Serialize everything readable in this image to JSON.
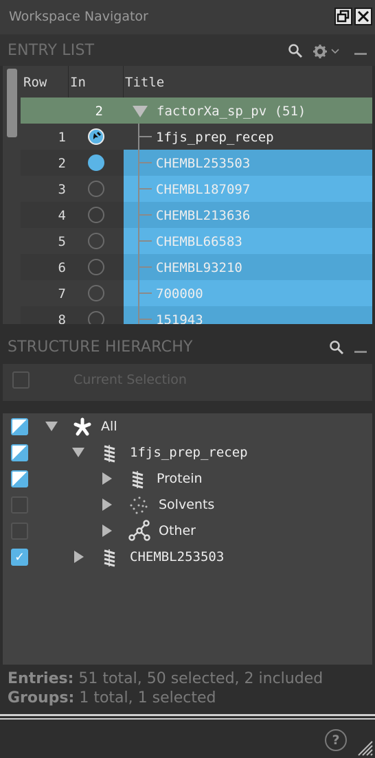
{
  "window": {
    "title": "Workspace Navigator",
    "restore_icon": "restore-icon",
    "close_icon": "close-icon"
  },
  "entry_list": {
    "header": "ENTRY LIST",
    "columns": [
      "Row",
      "In",
      "Title"
    ],
    "group": {
      "count": "2",
      "title": "factorXa_sp_pv (51)"
    },
    "rows": [
      {
        "row": "1",
        "title": "1fjs_prep_recep",
        "in_state": "pinned",
        "selected": false
      },
      {
        "row": "2",
        "title": "CHEMBL253503",
        "in_state": "included",
        "selected": true
      },
      {
        "row": "3",
        "title": "CHEMBL187097",
        "in_state": "excluded",
        "selected": true
      },
      {
        "row": "4",
        "title": "CHEMBL213636",
        "in_state": "excluded",
        "selected": true
      },
      {
        "row": "5",
        "title": "CHEMBL66583",
        "in_state": "excluded",
        "selected": true
      },
      {
        "row": "6",
        "title": "CHEMBL93210",
        "in_state": "excluded",
        "selected": true
      },
      {
        "row": "7",
        "title": "700000",
        "in_state": "excluded",
        "selected": true
      },
      {
        "row": "8",
        "title": "151943",
        "in_state": "excluded",
        "selected": true
      }
    ]
  },
  "structure_hierarchy": {
    "header": "STRUCTURE HIERARCHY",
    "current_selection": "Current Selection",
    "nodes": [
      {
        "label": "All",
        "icon": "asterisk-icon",
        "check": "partial",
        "expanded": true
      },
      {
        "label": "1fjs_prep_recep",
        "icon": "molecule-icon",
        "check": "partial",
        "expanded": true
      },
      {
        "label": "Protein",
        "icon": "protein-icon",
        "check": "partial",
        "expanded": false
      },
      {
        "label": "Solvents",
        "icon": "solvents-icon",
        "check": "unchecked",
        "expanded": false
      },
      {
        "label": "Other",
        "icon": "other-icon",
        "check": "unchecked",
        "expanded": false
      },
      {
        "label": "CHEMBL253503",
        "icon": "molecule-icon",
        "check": "checked",
        "expanded": false
      }
    ]
  },
  "status": {
    "entries_label": "Entries:",
    "entries_text": "51 total, 50 selected, 2 included",
    "groups_label": "Groups:",
    "groups_text": "1 total, 1 selected"
  },
  "help_label": "?",
  "colors": {
    "selected_row": "#5ab4e6",
    "group_row": "#6b8a6e",
    "background": "#2e2e2e"
  }
}
